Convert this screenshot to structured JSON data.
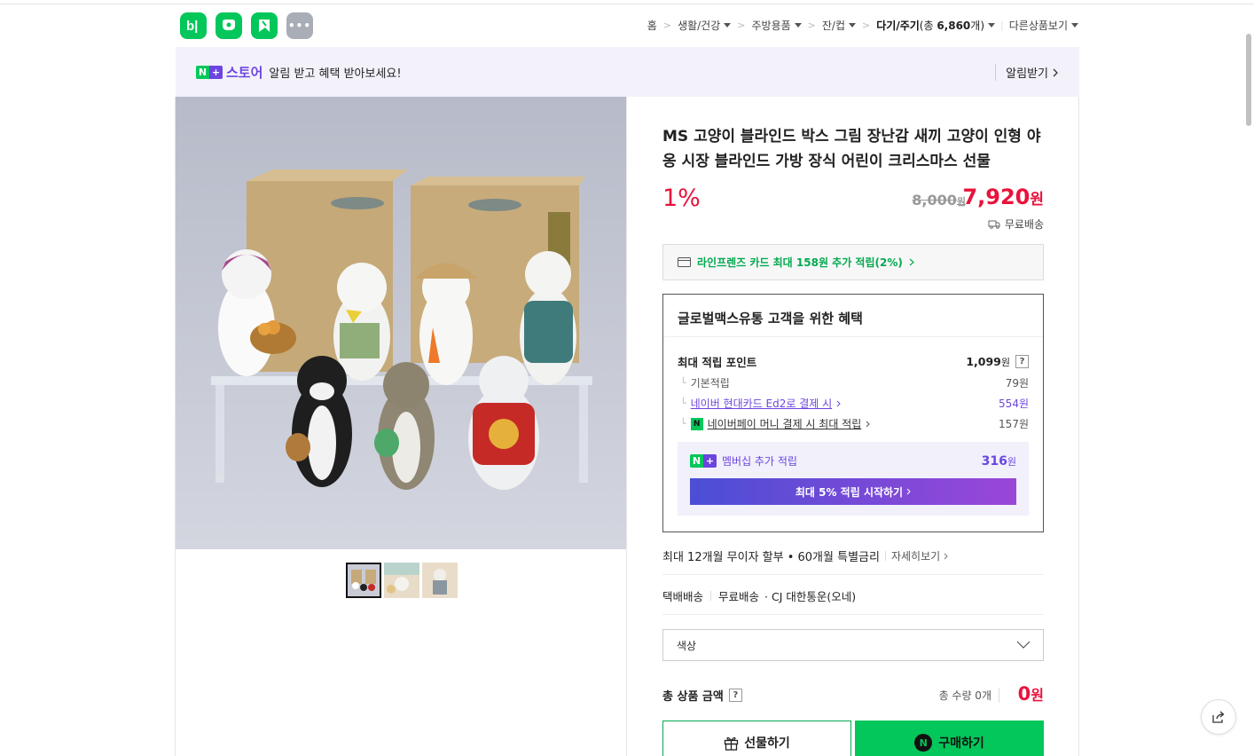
{
  "apps": [
    {
      "name": "band-app",
      "glyph": "b|"
    },
    {
      "name": "chat-app",
      "glyph": ""
    },
    {
      "name": "bookmark-app",
      "glyph": ""
    },
    {
      "name": "more-apps",
      "glyph": "•••"
    }
  ],
  "breadcrumb": {
    "home": "홈",
    "c1": "생활/건강",
    "c2": "주방용품",
    "c3": "잔/컵",
    "c4": "다기/주기",
    "c4_count_prefix": "(총 ",
    "c4_count": "6,860",
    "c4_count_suffix": "개)",
    "other": "다른상품보기",
    "sep": ">"
  },
  "banner": {
    "n": "N",
    "plus": "+",
    "store": "스토어",
    "message": "알림 받고 혜택 받아보세요!",
    "alarm": "알림받기"
  },
  "product": {
    "title": "MS 고양이 블라인드 박스 그림 장난감 새끼 고양이 인형 야옹 시장 블라인드 가방 장식 어린이 크리스마스 선물",
    "discount": "1%",
    "original_price": "8,000",
    "original_unit": "원",
    "sale_price": "7,920",
    "sale_unit": "원",
    "shipping": "무료배송",
    "thumbnails_count": 3
  },
  "card_promo": "라인프렌즈 카드 최대 158원 추가 적립(2%)",
  "benefit": {
    "title": "글로벌맥스유통 고객을 위한 혜택",
    "max_points_label": "최대 적립 포인트",
    "max_points_value": "1,099",
    "unit": "원",
    "qmark": "?",
    "tree": "└",
    "rows": [
      {
        "label": "기본적립",
        "value": "79원"
      },
      {
        "label": "네이버 현대카드 Ed2로 결제 시",
        "value": "554원"
      },
      {
        "label": "네이버페이 머니 결제 시 최대 적립",
        "value": "157원"
      }
    ],
    "npay_glyph": "N",
    "membership_label": "멤버십 추가 적립",
    "membership_value": "316",
    "membership_button": "최대 5% 적립 시작하기"
  },
  "installment": {
    "text": "최대 12개월 무이자 할부 • 60개월 특별금리",
    "more": "자세히보기"
  },
  "delivery": {
    "method": "택배배송",
    "fee": "무료배송",
    "carrier": "· CJ 대한통운(오네)"
  },
  "option_select": {
    "label": "색상"
  },
  "total": {
    "label": "총 상품 금액",
    "qmark": "?",
    "qty": "총 수량 0개",
    "amount": "0",
    "unit": "원"
  },
  "buttons": {
    "gift": "선물하기",
    "buy": "구매하기",
    "buy_glyph": "N"
  },
  "colors": {
    "naver_green": "#03c75a",
    "price_red": "#e8133c",
    "purple": "#6c45e0"
  }
}
